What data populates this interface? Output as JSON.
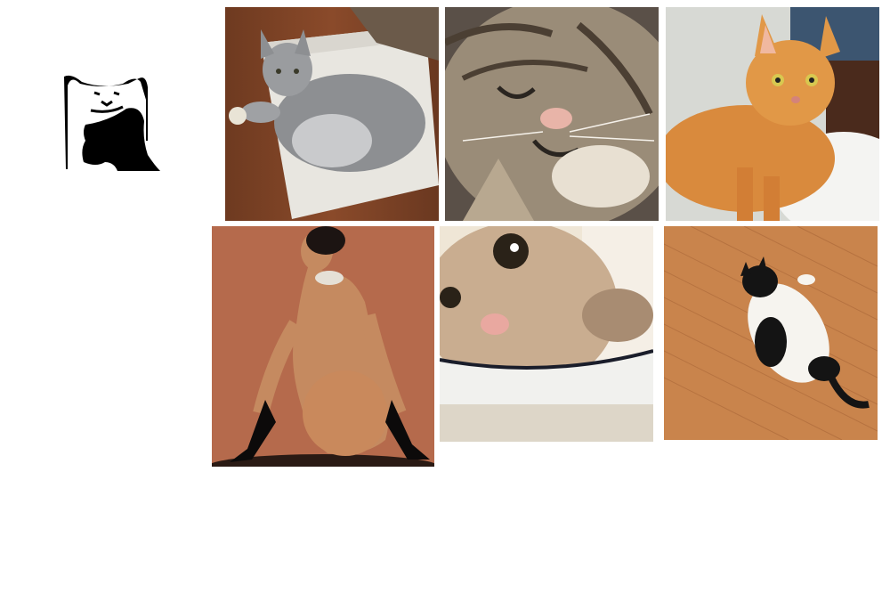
{
  "logo": {
    "icon": "cat-silhouette-logo-icon"
  },
  "gallery": {
    "tiles": [
      {
        "subject": "grey-cat-in-cardboard-box-photo"
      },
      {
        "subject": "sleeping-tabby-kitten-photo"
      },
      {
        "subject": "orange-cat-on-white-pillow-photo"
      },
      {
        "subject": "woman-in-black-gloves-photo"
      },
      {
        "subject": "cat-in-white-bowl-photo"
      },
      {
        "subject": "black-white-cat-on-wood-floor-photo"
      }
    ]
  },
  "colors": {
    "background": "#ffffff",
    "wood_floor": "#8a4a2a",
    "box_white": "#e8e6e0",
    "grey_cat": "#8d8f92",
    "tabby": "#9a8c78",
    "orange_cat": "#d98a3d",
    "peach_backdrop": "#b56a4c",
    "skin": "#c58a60",
    "bowl_white": "#f1f1ee",
    "light_wood": "#c9844c"
  }
}
